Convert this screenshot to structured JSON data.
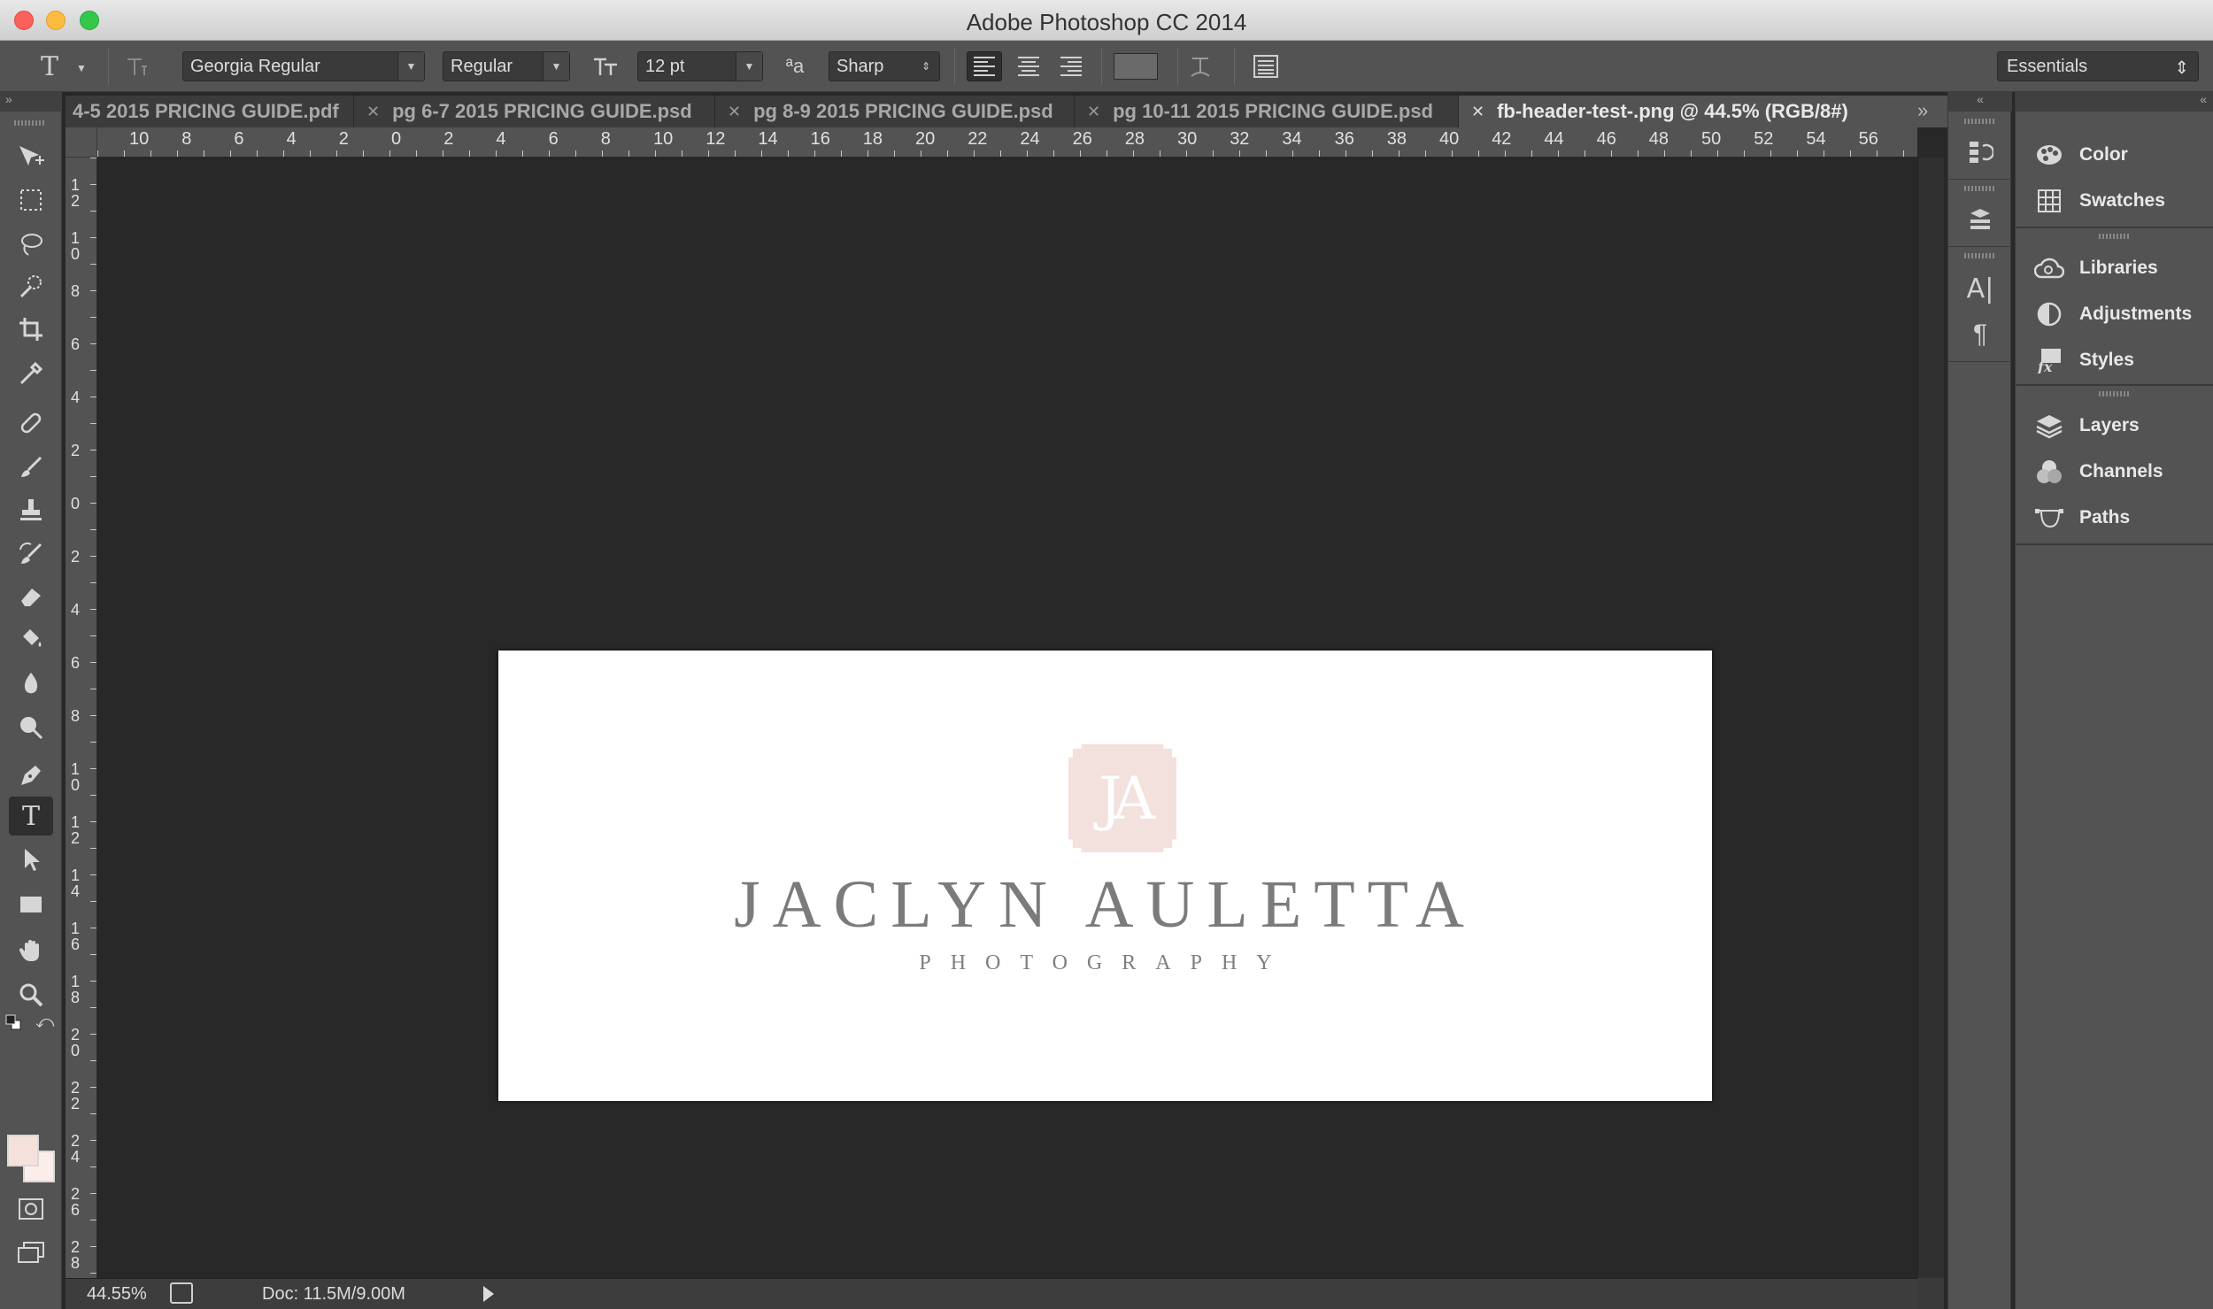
{
  "window": {
    "title": "Adobe Photoshop CC 2014"
  },
  "options": {
    "tool_glyph": "T",
    "font_family": "Georgia Regular",
    "font_style": "Regular",
    "font_size": "12 pt",
    "antialias_glyph": "ªa",
    "antialias": "Sharp",
    "workspace": "Essentials"
  },
  "tabs": [
    {
      "label": "4-5 2015 PRICING GUIDE.pdf",
      "active": false
    },
    {
      "label": "pg 6-7 2015 PRICING GUIDE.psd",
      "active": false
    },
    {
      "label": "pg 8-9 2015 PRICING GUIDE.psd",
      "active": false
    },
    {
      "label": "pg 10-11 2015 PRICING GUIDE.psd",
      "active": false
    },
    {
      "label": "fb-header-test-.png @ 44.5% (RGB/8#)",
      "active": true
    }
  ],
  "ruler": {
    "horizontal": [
      "10",
      "8",
      "6",
      "4",
      "2",
      "0",
      "2",
      "4",
      "6",
      "8",
      "10",
      "12",
      "14",
      "16",
      "18",
      "20",
      "22",
      "24",
      "26",
      "28",
      "30",
      "32",
      "34",
      "36",
      "38",
      "40",
      "42",
      "44",
      "46",
      "48",
      "50",
      "52",
      "54",
      "56"
    ],
    "vertical": [
      "1\n2",
      "1\n0",
      "8",
      "6",
      "4",
      "2",
      "0",
      "2",
      "4",
      "6",
      "8",
      "1\n0",
      "1\n2",
      "1\n4",
      "1\n6",
      "1\n8",
      "2\n0",
      "2\n2",
      "2\n4",
      "2\n6",
      "2\n8"
    ]
  },
  "document": {
    "monogram": "JA",
    "brand": "JACLYN AULETTA",
    "tagline": "PHOTOGRAPHY",
    "monogram_color": "#f3e1dd",
    "text_color": "#7b7b7b"
  },
  "status": {
    "zoom": "44.55%",
    "doc": "Doc: 11.5M/9.00M"
  },
  "panels": {
    "group1": [
      {
        "label": "Color",
        "icon": "palette-icon"
      },
      {
        "label": "Swatches",
        "icon": "grid-icon"
      }
    ],
    "group2": [
      {
        "label": "Libraries",
        "icon": "cloud-icon"
      },
      {
        "label": "Adjustments",
        "icon": "half-circle-icon"
      },
      {
        "label": "Styles",
        "icon": "fx-icon"
      }
    ],
    "group3": [
      {
        "label": "Layers",
        "icon": "layers-icon"
      },
      {
        "label": "Channels",
        "icon": "channels-icon"
      },
      {
        "label": "Paths",
        "icon": "pen-path-icon"
      }
    ]
  },
  "colors": {
    "foreground": "#f5e1dc",
    "background": "#fbeeea",
    "ui_panel": "#535353",
    "canvas_bg": "#282828"
  }
}
